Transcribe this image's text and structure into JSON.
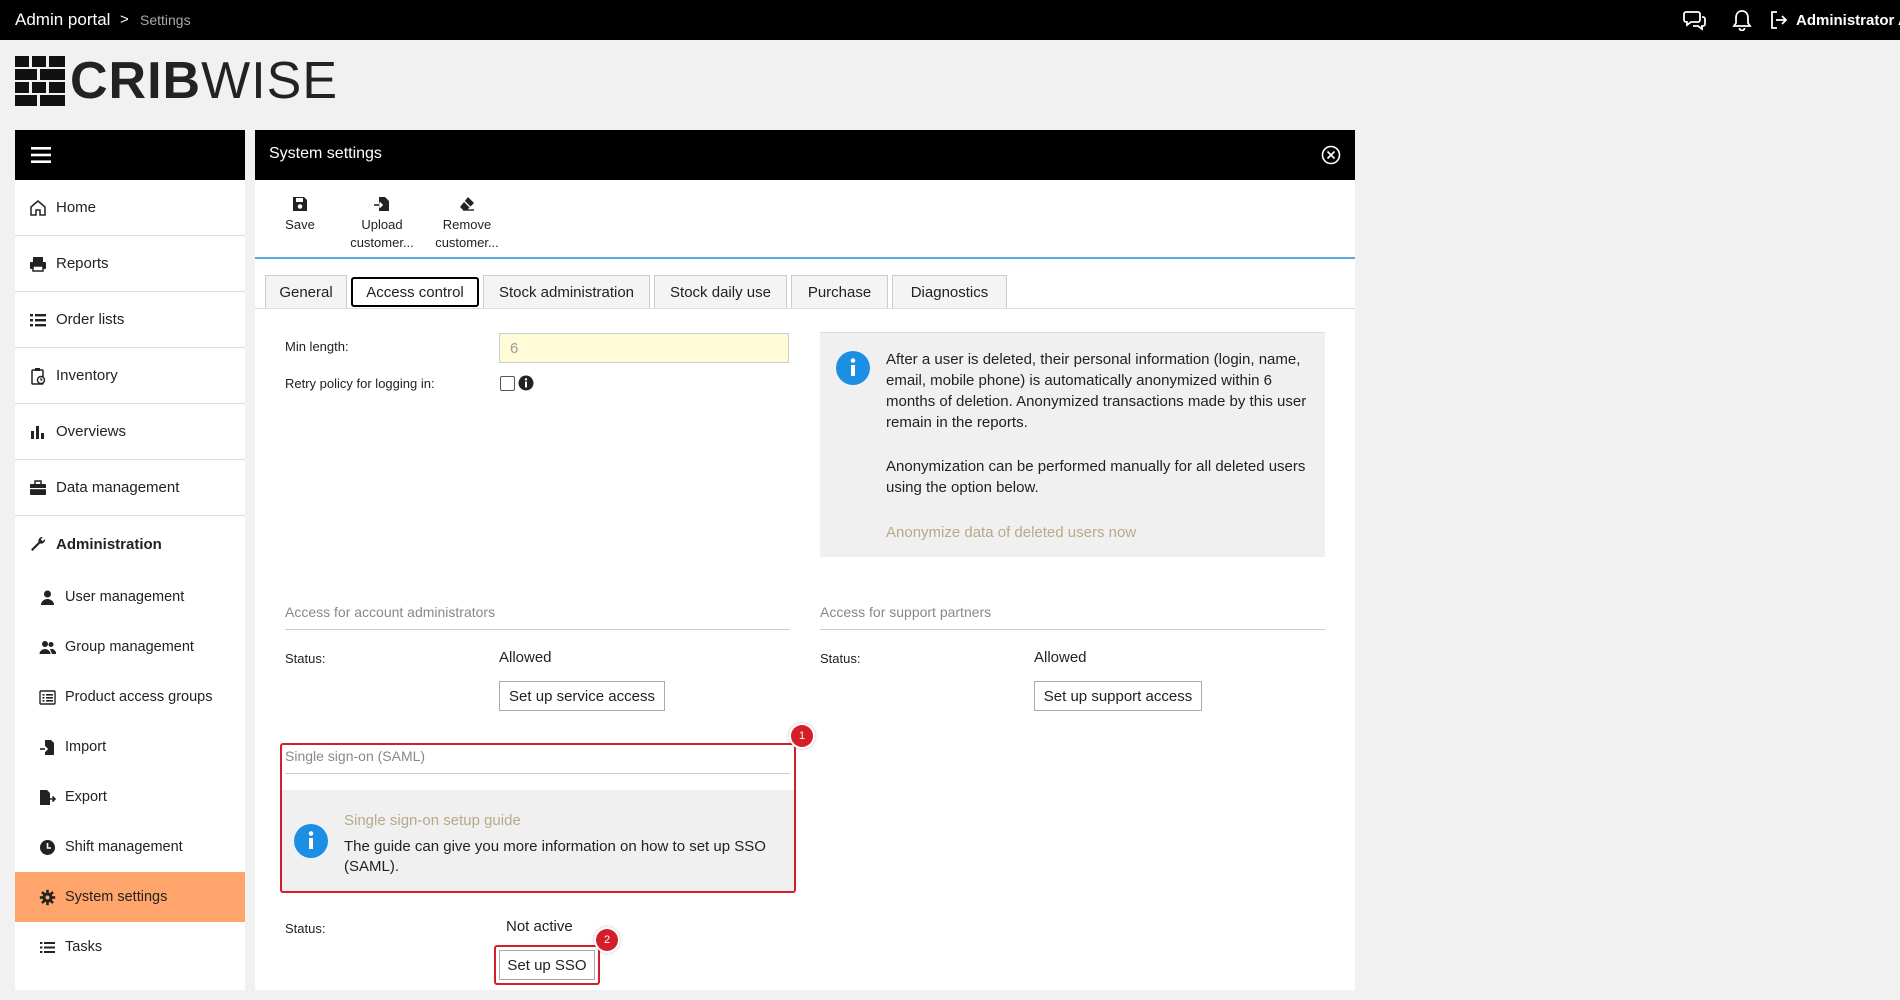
{
  "topbar": {
    "breadcrumb_root": "Admin portal",
    "breadcrumb_sep": ">",
    "breadcrumb_current": "Settings",
    "user_name": "Administrator A"
  },
  "logo": {
    "bold": "CRIB",
    "light": "WISE"
  },
  "sidebar": {
    "items": [
      {
        "label": "Home",
        "icon": "home-icon"
      },
      {
        "label": "Reports",
        "icon": "printer-icon"
      },
      {
        "label": "Order lists",
        "icon": "list-icon"
      },
      {
        "label": "Inventory",
        "icon": "clipboard-icon"
      },
      {
        "label": "Overviews",
        "icon": "bar-chart-icon"
      },
      {
        "label": "Data management",
        "icon": "briefcase-icon"
      }
    ],
    "admin_label": "Administration",
    "sub_items": [
      {
        "label": "User management",
        "icon": "user-icon"
      },
      {
        "label": "Group management",
        "icon": "users-icon"
      },
      {
        "label": "Product access groups",
        "icon": "list-box-icon"
      },
      {
        "label": "Import",
        "icon": "import-icon"
      },
      {
        "label": "Export",
        "icon": "export-icon"
      },
      {
        "label": "Shift management",
        "icon": "clock-icon"
      },
      {
        "label": "System settings",
        "icon": "gear-icon",
        "active": true
      },
      {
        "label": "Tasks",
        "icon": "tasks-icon"
      }
    ],
    "active_color": "#ffa56b"
  },
  "panel": {
    "title": "System settings",
    "toolbar": {
      "save": "Save",
      "upload_1": "Upload",
      "upload_2": "customer...",
      "remove_1": "Remove",
      "remove_2": "customer..."
    },
    "tabs": [
      "General",
      "Access control",
      "Stock administration",
      "Stock daily use",
      "Purchase",
      "Diagnostics"
    ],
    "active_tab": "Access control"
  },
  "password": {
    "min_length_label": "Min length:",
    "min_length_value": "6",
    "retry_label": "Retry policy for logging in:"
  },
  "anonymize": {
    "p1": "After a user is deleted, their personal information (login, name, email, mobile phone) is automatically anonymized within 6 months of deletion. Anonymized transactions made by this user remain in the reports.",
    "p2": "Anonymization can be performed manually for all deleted users using the option below.",
    "link": "Anonymize data of deleted users now"
  },
  "admin_access": {
    "title": "Access for account administrators",
    "status_label": "Status:",
    "status_value": "Allowed",
    "button": "Set up service access"
  },
  "support_access": {
    "title": "Access for support partners",
    "status_label": "Status:",
    "status_value": "Allowed",
    "button": "Set up support access"
  },
  "sso": {
    "title": "Single sign-on (SAML)",
    "guide_link": "Single sign-on setup guide",
    "guide_text": "The guide can give you more information on how to set up SSO (SAML).",
    "status_label": "Status:",
    "status_value": "Not active",
    "button": "Set up SSO",
    "badge_1": "1",
    "badge_2": "2"
  },
  "colors": {
    "info_blue": "#1a8fe3",
    "highlight_red": "#d41f2b",
    "link_muted": "#b8a988",
    "toolbar_line": "#5aa9e0"
  }
}
